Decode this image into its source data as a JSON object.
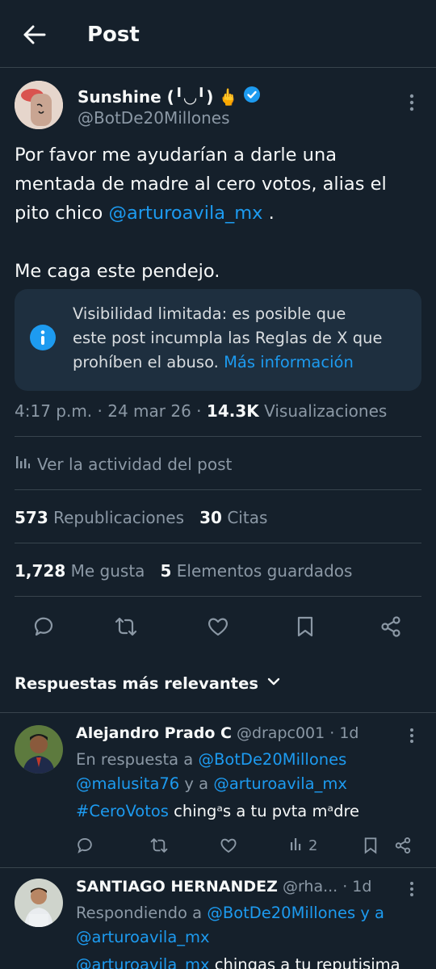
{
  "header": {
    "title": "Post"
  },
  "post": {
    "display_name": "Sunshine (╹◡╹)",
    "name_emoji": "🖕",
    "handle": "@BotDe20Millones",
    "text_lines": [
      "Por favor me ayudarían a darle una",
      "mentada de madre al cero votos,  alias el",
      "pito chico "
    ],
    "mention": "@arturoavila_mx",
    "mention_suffix": " .",
    "text_line_4": "Me caga este pendejo.",
    "notice": {
      "line1": "Visibilidad limitada: es posible que",
      "line2": "este post incumpla las Reglas de X que",
      "line3": "prohíben el abuso. ",
      "link": "Más información"
    },
    "time": "4:17 p.m.",
    "date": "24 mar 26",
    "views_count": "14.3K",
    "views_label": "Visualizaciones",
    "activity_label": "Ver la actividad del post",
    "reposts_count": "573",
    "reposts_label": "Republicaciones",
    "quotes_count": "30",
    "quotes_label": "Citas",
    "likes_count": "1,728",
    "likes_label": "Me gusta",
    "bookmarks_count": "5",
    "bookmarks_label": "Elementos guardados"
  },
  "replies_sort_label": "Respuestas más relevantes",
  "replies": [
    {
      "name": "Alejandro Prado C",
      "handle": "@drapc001",
      "time": "· 1d",
      "reply_to_prefix": "En respuesta a ",
      "reply_to_1": "@BotDe20Millones",
      "reply_to_2": "@malusita76",
      "reply_to_and": " y a ",
      "reply_to_3": "@arturoavila_mx",
      "hashtag": "#CeroVotos",
      "text": " chingᵃs a tu pvta mᵃdre",
      "views": "2"
    },
    {
      "name": "SANTIAGO HERNANDEZ",
      "handle": "@rha...",
      "time": "· 1d",
      "reply_to_prefix": "Respondiendo a ",
      "reply_to_1": "@BotDe20Millones y a",
      "reply_to_2": "@arturoavila_mx",
      "mention": "@arturoavila_mx",
      "text": " chingas a tu reputisima"
    }
  ],
  "colors": {
    "background": "#15202b",
    "accent": "#1d9bf0",
    "muted": "#8b98a5"
  }
}
